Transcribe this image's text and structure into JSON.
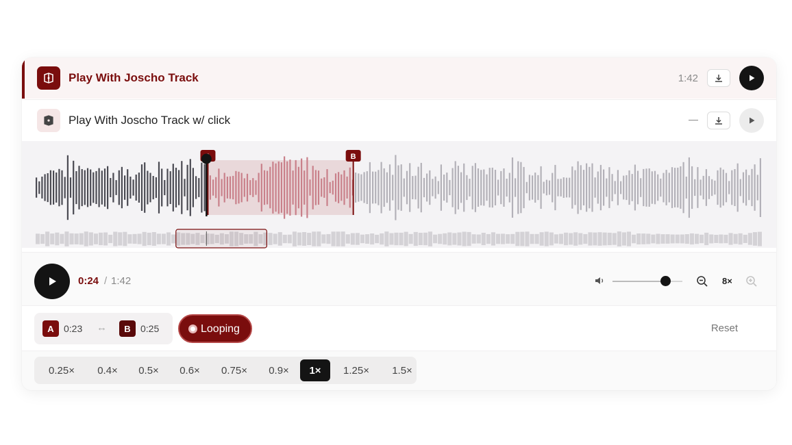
{
  "tracks": [
    {
      "title": "Play With Joscho Track",
      "duration": "1:42",
      "active": true
    },
    {
      "title": "Play With Joscho Track w/ click",
      "duration": "—",
      "active": false
    }
  ],
  "player": {
    "current_time": "0:24",
    "separator": "/",
    "total_time": "1:42",
    "progress": 0.235,
    "volume": 0.75,
    "zoom_level": "8×"
  },
  "loop": {
    "a_label": "A",
    "a_time": "0:23",
    "b_label": "B",
    "b_time": "0:25",
    "arrow": "↔",
    "looping_label": "Looping",
    "reset_label": "Reset",
    "region_start": 0.237,
    "region_end": 0.437
  },
  "speeds": {
    "options": [
      "0.25×",
      "0.4×",
      "0.5×",
      "0.6×",
      "0.75×",
      "0.9×",
      "1×",
      "1.25×",
      "1.5×"
    ],
    "selected": "1×"
  },
  "colors": {
    "accent": "#7a0d0d",
    "played": "#4a4a52",
    "unplayed": "#b3b1b8",
    "region_played": "#8a1010",
    "region_unplayed": "#c9808a"
  },
  "icons": {
    "track": "music-book-icon",
    "download": "download-icon",
    "play": "play-icon",
    "volume": "volume-icon",
    "zoom_out": "zoom-out-icon",
    "zoom_in": "zoom-in-icon"
  }
}
